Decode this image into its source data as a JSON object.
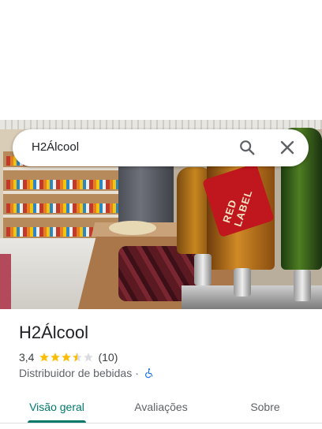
{
  "search": {
    "query": "H2Álcool"
  },
  "photo": {
    "bottle_label": "RED LABEL"
  },
  "place": {
    "name": "H2Álcool",
    "rating": "3,4",
    "rating_stars": 3.4,
    "reviews_count": "(10)",
    "category": "Distribuidor de bebidas",
    "separator": "·"
  },
  "tabs": [
    {
      "label": "Visão geral",
      "active": true
    },
    {
      "label": "Avaliações",
      "active": false
    },
    {
      "label": "Sobre",
      "active": false
    }
  ],
  "colors": {
    "accent": "#00796b",
    "star": "#fbbc04",
    "star_empty": "#dadce0"
  }
}
